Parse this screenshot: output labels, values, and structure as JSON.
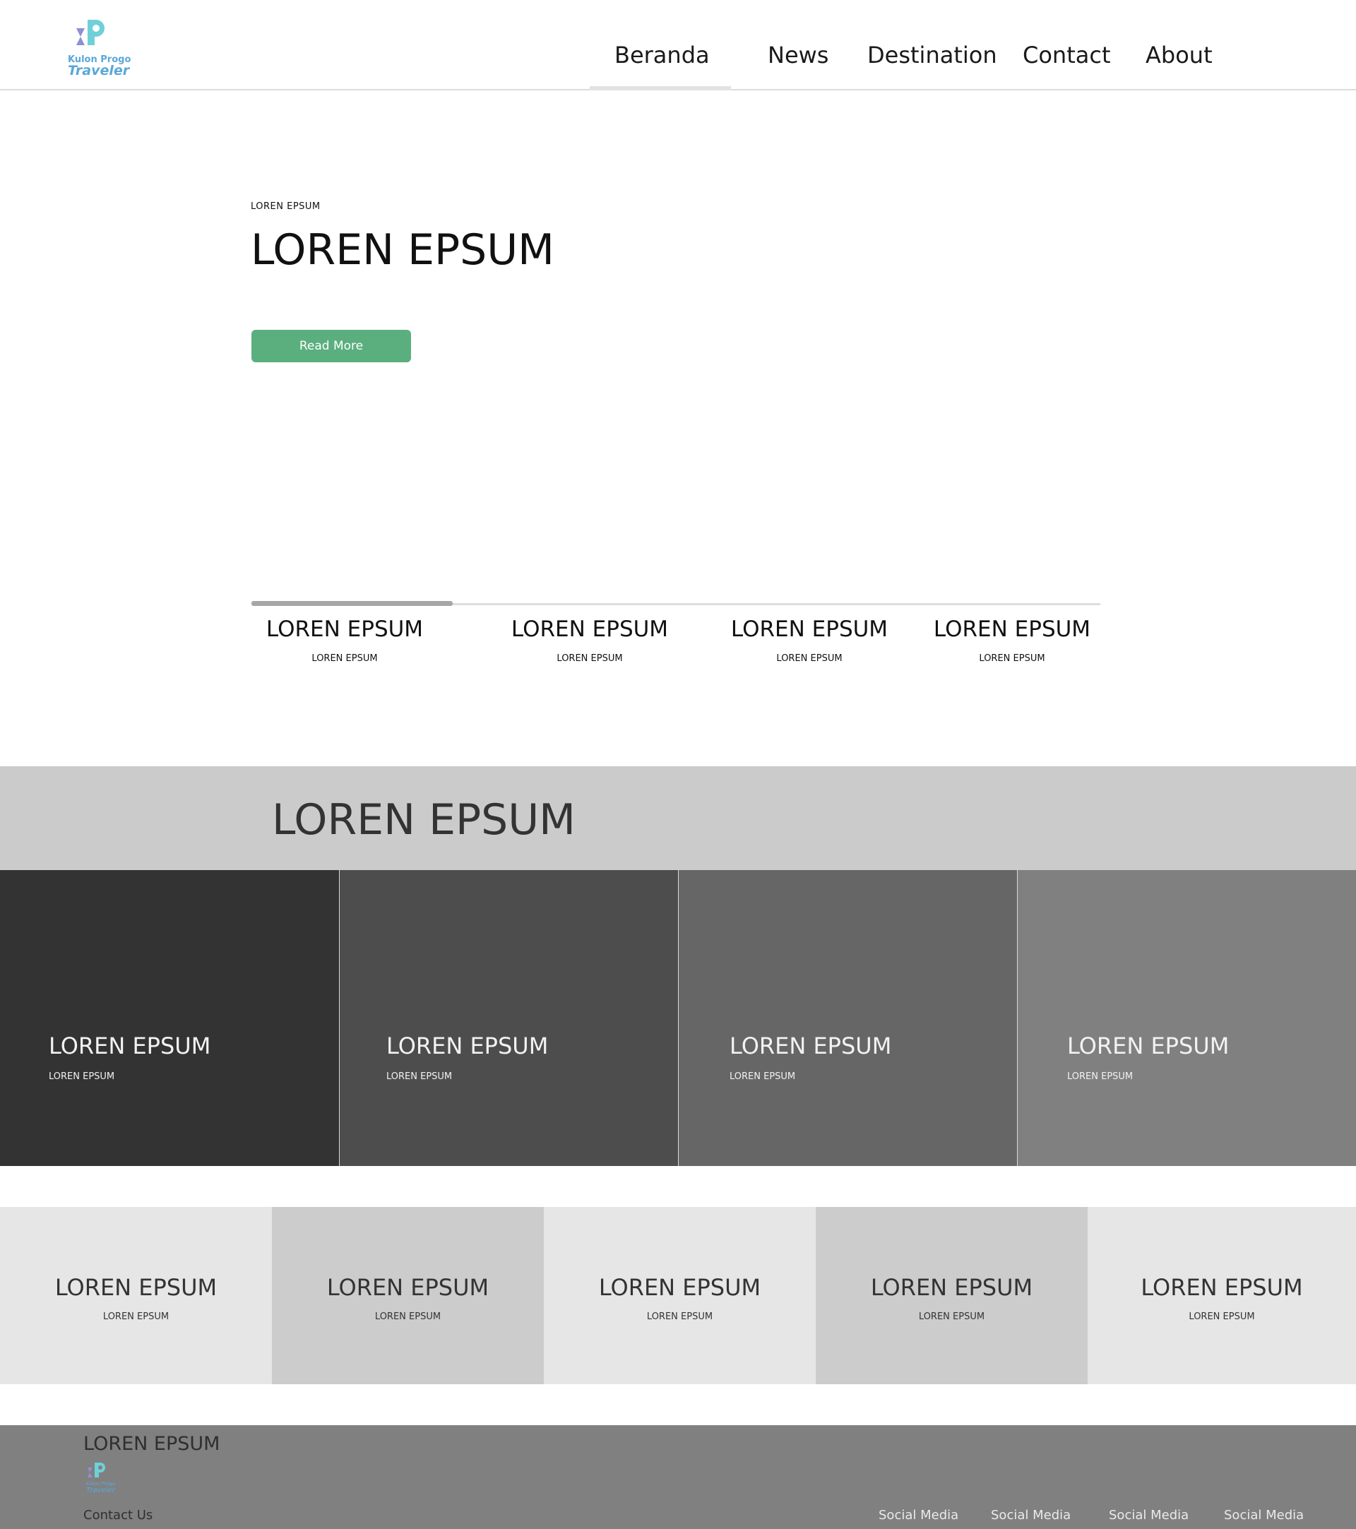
{
  "brand": {
    "logo_line1": "Kulon Progo",
    "logo_line2": "Traveler",
    "colors": {
      "logo_blue": "#5aa7d8",
      "logo_teal": "#6fd0d8",
      "logo_purple": "#8f8fd6"
    }
  },
  "nav": {
    "items": [
      {
        "label": "Beranda",
        "active": true
      },
      {
        "label": "News"
      },
      {
        "label": "Destination"
      },
      {
        "label": "Contact"
      },
      {
        "label": "About"
      }
    ]
  },
  "hero": {
    "kicker": "LOREN EPSUM",
    "title": "LOREN EPSUM",
    "button_label": "Read More",
    "button_color": "#5baf7f"
  },
  "slider": {
    "active_index": 0,
    "tabs": [
      {
        "title": "LOREN EPSUM",
        "subtitle": "LOREN EPSUM"
      },
      {
        "title": "LOREN EPSUM",
        "subtitle": "LOREN EPSUM"
      },
      {
        "title": "LOREN EPSUM",
        "subtitle": "LOREN EPSUM"
      },
      {
        "title": "LOREN EPSUM",
        "subtitle": "LOREN EPSUM"
      }
    ]
  },
  "section": {
    "title": "LOREN EPSUM",
    "cards": [
      {
        "title": "LOREN EPSUM",
        "subtitle": "LOREN EPSUM",
        "bg": "#333333"
      },
      {
        "title": "LOREN EPSUM",
        "subtitle": "LOREN EPSUM",
        "bg": "#4d4d4d"
      },
      {
        "title": "LOREN EPSUM",
        "subtitle": "LOREN EPSUM",
        "bg": "#666666"
      },
      {
        "title": "LOREN EPSUM",
        "subtitle": "LOREN EPSUM",
        "bg": "#808080"
      }
    ],
    "tiles": [
      {
        "title": "LOREN EPSUM",
        "subtitle": "LOREN EPSUM",
        "bg": "#e6e6e6"
      },
      {
        "title": "LOREN EPSUM",
        "subtitle": "LOREN EPSUM",
        "bg": "#cccccc"
      },
      {
        "title": "LOREN EPSUM",
        "subtitle": "LOREN EPSUM",
        "bg": "#e6e6e6"
      },
      {
        "title": "LOREN EPSUM",
        "subtitle": "LOREN EPSUM",
        "bg": "#cccccc"
      },
      {
        "title": "LOREN EPSUM",
        "subtitle": "LOREN EPSUM",
        "bg": "#e6e6e6"
      }
    ]
  },
  "footer": {
    "title": "LOREN EPSUM",
    "contact_label": "Contact Us",
    "social": [
      "Social Media",
      "Social Media",
      "Social Media",
      "Social Media"
    ]
  }
}
